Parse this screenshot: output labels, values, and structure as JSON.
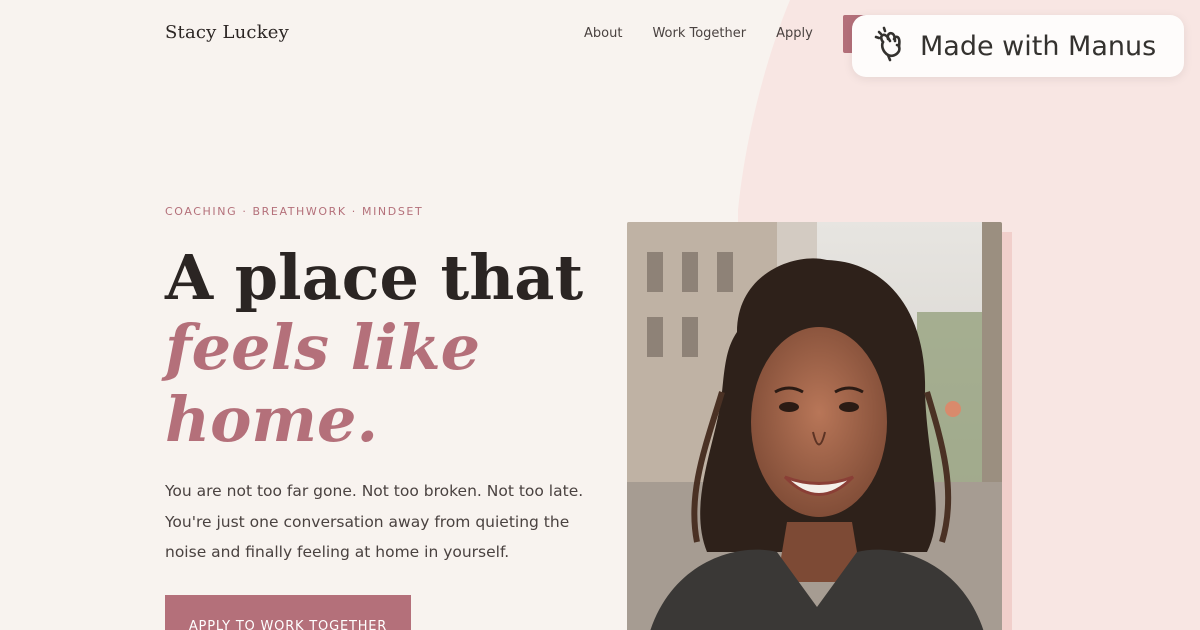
{
  "brand": {
    "name": "Stacy Luckey"
  },
  "nav": {
    "items": [
      {
        "label": "About"
      },
      {
        "label": "Work Together"
      },
      {
        "label": "Apply"
      }
    ]
  },
  "badge": {
    "label": "Made with Manus",
    "icon": "manus-hand-icon"
  },
  "hero": {
    "eyebrow": "COACHING · BREATHWORK · MINDSET",
    "headline_line1": "A place that",
    "headline_line2": "feels like",
    "headline_line3": "home.",
    "lede_line1": "You are not too far gone. Not too broken. Not too late.",
    "lede_line2": "You're just one conversation away from quieting the",
    "lede_line3": "noise and finally feeling at home in yourself.",
    "cta_label": "APPLY TO WORK TOGETHER"
  },
  "colors": {
    "background": "#f8f3ef",
    "accent": "#b4707a",
    "blob": "#f8e6e3",
    "text": "#2b2523"
  }
}
